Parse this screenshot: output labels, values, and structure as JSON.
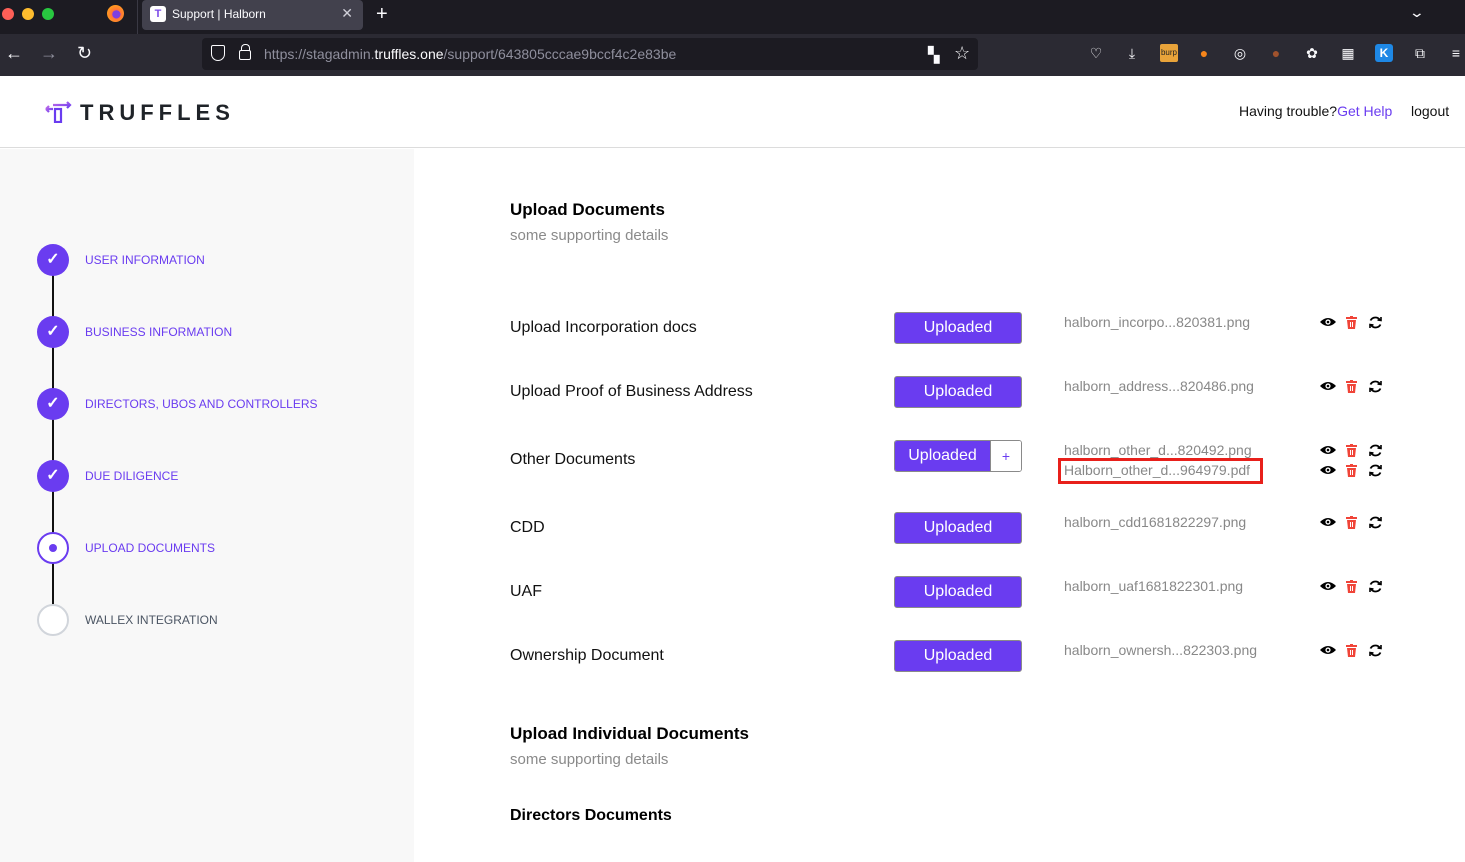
{
  "browser": {
    "tab_title": "Support | Halborn",
    "tab_favicon": "T",
    "url_prefix": "https://stagadmin.",
    "url_host": "truffles.one",
    "url_path": "/support/643805cccae9bccf4c2e83be",
    "extensions": [
      "pocket-icon",
      "download-icon",
      "burp-icon",
      "metamask-icon",
      "extension-swirl-icon",
      "cookie-icon",
      "cookie-editor-icon",
      "grid-plus-icon",
      "k-extension-icon",
      "extensions-puzzle-icon",
      "menu-icon"
    ],
    "burp_label": "burp",
    "k_label": "K"
  },
  "header": {
    "logo_text": "TRUFFLES",
    "help_prefix": "Having trouble?",
    "help_link": "Get Help",
    "logout": "logout"
  },
  "steps": [
    {
      "label": "USER INFORMATION",
      "status": "done"
    },
    {
      "label": "BUSINESS INFORMATION",
      "status": "done"
    },
    {
      "label": "DIRECTORS, UBOS AND CONTROLLERS",
      "status": "done"
    },
    {
      "label": "DUE DILIGENCE",
      "status": "done"
    },
    {
      "label": "UPLOAD DOCUMENTS",
      "status": "active"
    },
    {
      "label": "WALLEX INTEGRATION",
      "status": "pending"
    }
  ],
  "upload_section": {
    "title": "Upload Documents",
    "subtitle": "some supporting details",
    "rows": [
      {
        "label": "Upload Incorporation docs",
        "button": "Uploaded",
        "files": [
          "halborn_incorpo...820381.png"
        ]
      },
      {
        "label": "Upload Proof of Business Address",
        "button": "Uploaded",
        "files": [
          "halborn_address...820486.png"
        ]
      },
      {
        "label": "Other Documents",
        "button": "Uploaded",
        "add": "+",
        "files": [
          "halborn_other_d...820492.png",
          "Halborn_other_d...964979.pdf"
        ]
      },
      {
        "label": "CDD",
        "button": "Uploaded",
        "files": [
          "halborn_cdd1681822297.png"
        ]
      },
      {
        "label": "UAF",
        "button": "Uploaded",
        "files": [
          "halborn_uaf1681822301.png"
        ]
      },
      {
        "label": "Ownership Document",
        "button": "Uploaded",
        "files": [
          "halborn_ownersh...822303.png"
        ]
      }
    ]
  },
  "individual_section": {
    "title": "Upload Individual Documents",
    "subtitle": "some supporting details",
    "directors_title": "Directors Documents"
  },
  "colors": {
    "accent": "#6a3cf0",
    "delete": "#f04438",
    "highlight": "#e8201b"
  },
  "icons": {
    "check": "✓",
    "back": "←",
    "forward": "→",
    "reload": "↻",
    "close": "✕",
    "new_tab": "+",
    "star": "☆",
    "chevron": "⌄"
  }
}
